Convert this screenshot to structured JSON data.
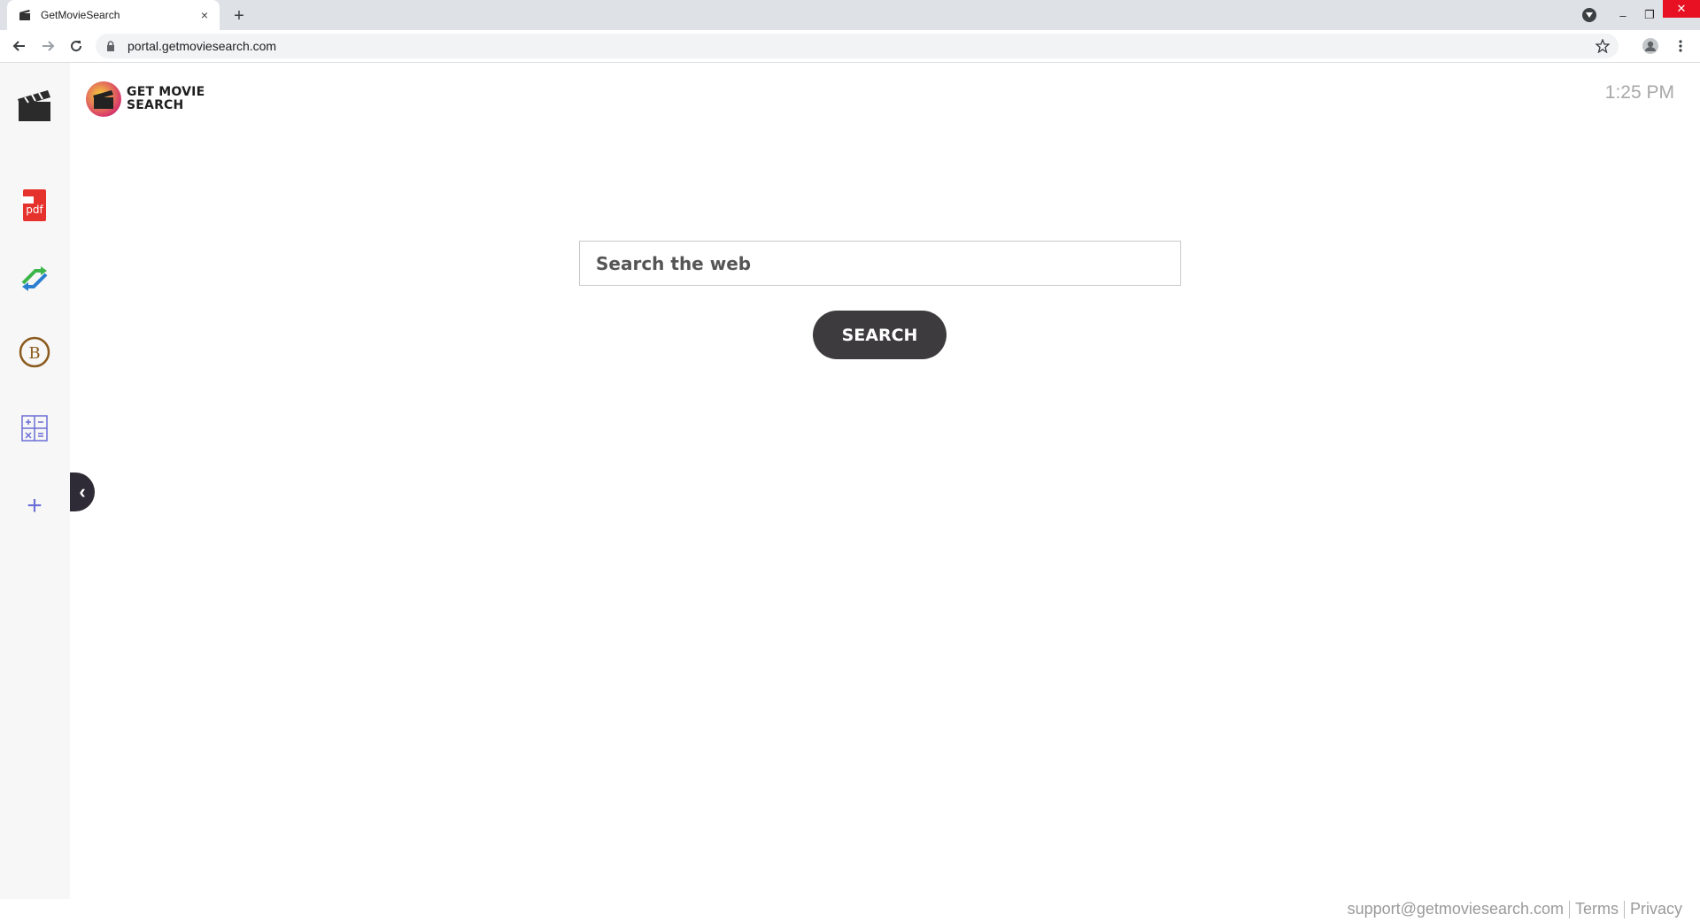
{
  "browser": {
    "tab_title": "GetMovieSearch",
    "url": "portal.getmoviesearch.com",
    "new_tab_symbol": "+",
    "close_symbol": "×"
  },
  "window_controls": {
    "minimize": "–",
    "restore": "❐",
    "close": "✕"
  },
  "sidebar": {
    "items": [
      {
        "name": "clapperboard-icon"
      },
      {
        "name": "pdf-icon",
        "label": "pdf"
      },
      {
        "name": "arrows-icon"
      },
      {
        "name": "bitcoin-icon",
        "label": "B"
      },
      {
        "name": "calculator-icon"
      },
      {
        "name": "add-icon",
        "label": "+"
      }
    ],
    "collapse_symbol": "‹"
  },
  "header": {
    "logo_line1": "GET MOVIE",
    "logo_line2": "SEARCH",
    "time": "1:25 PM"
  },
  "search": {
    "placeholder": "Search the web",
    "button_label": "SEARCH"
  },
  "footer": {
    "support_email": "support@getmoviesearch.com",
    "terms": "Terms",
    "privacy": "Privacy"
  },
  "colors": {
    "accent_dark": "#3d3b3d",
    "sidebar_bg": "#f7f7f7",
    "pdf_red": "#e5322d",
    "calc_blue": "#6b6fd6"
  }
}
